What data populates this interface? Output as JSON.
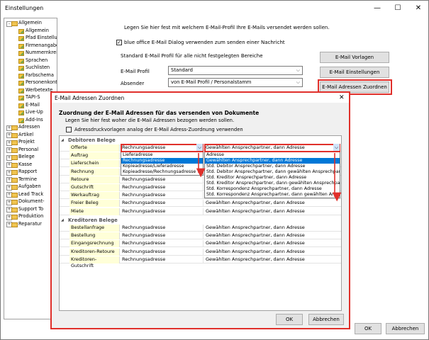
{
  "window": {
    "title": "Einstellungen",
    "min": "—",
    "max": "☐",
    "close": "✕"
  },
  "tree": [
    {
      "label": "Allgemein",
      "level": 0,
      "exp": "-",
      "icon": "folder"
    },
    {
      "label": "Allgemein",
      "level": 1,
      "icon": "pencil"
    },
    {
      "label": "Pfad Einstellungen",
      "level": 1,
      "icon": "pencil"
    },
    {
      "label": "Firmenangaben",
      "level": 1,
      "icon": "pencil"
    },
    {
      "label": "Nummernkreise",
      "level": 1,
      "icon": "pencil"
    },
    {
      "label": "Sprachen",
      "level": 1,
      "icon": "pencil"
    },
    {
      "label": "Suchlisten",
      "level": 1,
      "icon": "pencil"
    },
    {
      "label": "Farbschema",
      "level": 1,
      "icon": "pencil"
    },
    {
      "label": "Personenkontos",
      "level": 1,
      "icon": "pencil"
    },
    {
      "label": "Werbetexte",
      "level": 1,
      "icon": "pencil"
    },
    {
      "label": "TAPI-S",
      "level": 1,
      "icon": "pencil"
    },
    {
      "label": "E-Mail",
      "level": 1,
      "icon": "pencil"
    },
    {
      "label": "Live-Up",
      "level": 1,
      "icon": "pencil"
    },
    {
      "label": "Add-Ins",
      "level": 1,
      "icon": "pencil"
    },
    {
      "label": "Adressen",
      "level": 0,
      "exp": "+",
      "icon": "folder"
    },
    {
      "label": "Artikel",
      "level": 0,
      "exp": "+",
      "icon": "folder"
    },
    {
      "label": "Projekt",
      "level": 0,
      "exp": "+",
      "icon": "folder"
    },
    {
      "label": "Personal",
      "level": 0,
      "exp": "+",
      "icon": "folder"
    },
    {
      "label": "Belege",
      "level": 0,
      "exp": "+",
      "icon": "folder"
    },
    {
      "label": "Kasse",
      "level": 0,
      "exp": "+",
      "icon": "folder"
    },
    {
      "label": "Rapport",
      "level": 0,
      "exp": "+",
      "icon": "folder"
    },
    {
      "label": "Termine",
      "level": 0,
      "exp": "+",
      "icon": "folder"
    },
    {
      "label": "Aufgaben",
      "level": 0,
      "exp": "+",
      "icon": "folder"
    },
    {
      "label": "Lead Track",
      "level": 0,
      "exp": "+",
      "icon": "folder"
    },
    {
      "label": "Dokument-",
      "level": 0,
      "exp": "+",
      "icon": "folder"
    },
    {
      "label": "Support To",
      "level": 0,
      "exp": "+",
      "icon": "folder"
    },
    {
      "label": "Produktion",
      "level": 0,
      "exp": "+",
      "icon": "folder"
    },
    {
      "label": "Reparatur",
      "level": 0,
      "exp": "+",
      "icon": "folder"
    }
  ],
  "main": {
    "intro": "Legen Sie hier fest mit welchem E-Mail-Profil Ihre E-Mails versendet werden sollen.",
    "blue_office_check": "blue office E-Mail Dialog verwenden zum senden einer Nachricht",
    "group_label": "Standard E-Mail Profil für alle nicht festgelegten Bereiche",
    "profile_label": "E-Mail Profil",
    "profile_value": "Standard",
    "sender_label": "Absender",
    "sender_value": "von E-Mail Profil / Personalstamm",
    "btn_vorlagen": "E-Mail Vorlagen",
    "btn_einstellungen": "E-Mail Einstellungen",
    "btn_zuordnen": "E-Mail Adressen Zuordnen",
    "ok": "OK",
    "cancel": "Abbrechen"
  },
  "dialog": {
    "title": "E-Mail Adressen Zuordnen",
    "close": "✕",
    "heading": "Zuordnung der E-Mail Adressen für das versenden von Dokumente",
    "sub": "Legen Sie hier fest woher die E-Mail Adressen bezogen werden sollen.",
    "check": "Adressdruckvorlagen analog der E-Mail Adress-Zuordnung verwenden",
    "group1": "Debitoren Belege",
    "group2": "Kreditoren Belege",
    "rows1": [
      {
        "name": "Offerte",
        "src": "Rechnungsadresse",
        "target": "Gewählten Ansprechpartner, dann Adresse"
      },
      {
        "name": "Auftrag",
        "src": "",
        "target": ""
      },
      {
        "name": "Lieferschein",
        "src": "",
        "target": ""
      },
      {
        "name": "Rechnung",
        "src": "",
        "target": ""
      },
      {
        "name": "Retoure",
        "src": "Rechnungsadresse",
        "target": ""
      },
      {
        "name": "Gutschrift",
        "src": "Rechnungsadresse",
        "target": ""
      },
      {
        "name": "Werkauftrag",
        "src": "Rechnungsadresse",
        "target": ""
      },
      {
        "name": "Freier Beleg",
        "src": "Rechnungsadresse",
        "target": "Gewählten Ansprechpartner, dann Adresse"
      },
      {
        "name": "Miete",
        "src": "Rechnungsadresse",
        "target": "Gewählten Ansprechpartner, dann Adresse"
      }
    ],
    "rows2": [
      {
        "name": "Bestellanfrage",
        "src": "Rechnungsadresse",
        "target": "Gewählten Ansprechpartner, dann Adresse"
      },
      {
        "name": "Bestellung",
        "src": "Rechnungsadresse",
        "target": "Gewählten Ansprechpartner, dann Adresse"
      },
      {
        "name": "Eingangsrechnung",
        "src": "Rechnungsadresse",
        "target": "Gewählten Ansprechpartner, dann Adresse"
      },
      {
        "name": "Kreditoren-Retoure",
        "src": "Rechnungsadresse",
        "target": "Gewählten Ansprechpartner, dann Adresse"
      },
      {
        "name": "Kreditoren-Gutschrift",
        "src": "Rechnungsadresse",
        "target": "Gewählten Ansprechpartner, dann Adresse"
      }
    ],
    "dropdown1": [
      "Lieferadresse",
      "Rechnungsadresse",
      "Kopieadresse/Lieferadresse",
      "Kopieadresse/Rechnungsadresse"
    ],
    "dropdown1_selected": 1,
    "dropdown2": [
      "Adresse",
      "Gewählten Ansprechpartner, dann Adresse",
      "Std. Debitor Ansprechpartner, dann Adresse",
      "Std. Debitor Ansprechpartner, dann gewählten Ansprechpartner",
      "Std. Kreditor Ansprechpartner, dann Adresse",
      "Std. Kreditor Ansprechpartner, dann gewählten Ansprechpartner",
      "Std. Korrespondenz Ansprechpartner, dann Adresse",
      "Std. Korrespondenz Ansprechpartner, dann gewählten Ansprechpartner"
    ],
    "dropdown2_selected": 1,
    "ok": "OK",
    "cancel": "Abbrechen"
  },
  "accent_red": "#e0302b",
  "selection_blue": "#0078d7"
}
